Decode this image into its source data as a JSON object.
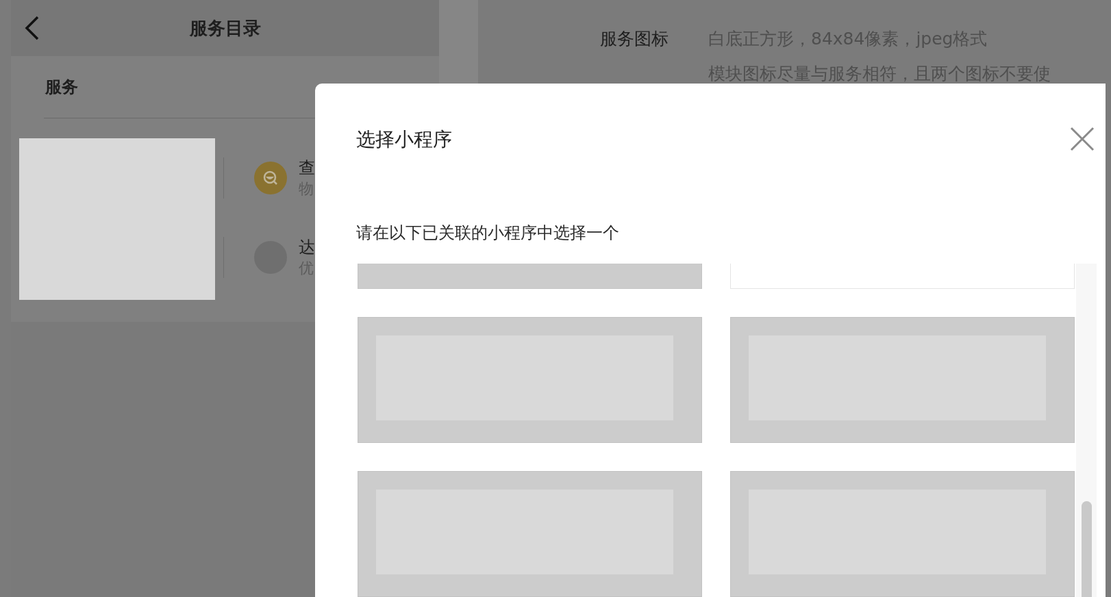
{
  "left_panel": {
    "title": "服务目录",
    "section": "服务",
    "services": [
      {
        "title": "查",
        "subtitle": "物",
        "kind": "search"
      },
      {
        "title": "达",
        "subtitle": "优",
        "kind": "blank"
      }
    ]
  },
  "right_panel": {
    "label": "服务图标",
    "hints": [
      "白底正方形，84x84像素，jpeg格式",
      "模块图标尽量与服务相符，且两个图标不要使"
    ]
  },
  "dialog": {
    "title": "选择小程序",
    "instruction": "请在以下已关联的小程序中选择一个",
    "options": [
      {
        "kind": "filled"
      },
      {
        "kind": "outlined"
      },
      {
        "kind": "thumb"
      },
      {
        "kind": "thumb"
      },
      {
        "kind": "thumb"
      },
      {
        "kind": "thumb"
      }
    ]
  }
}
